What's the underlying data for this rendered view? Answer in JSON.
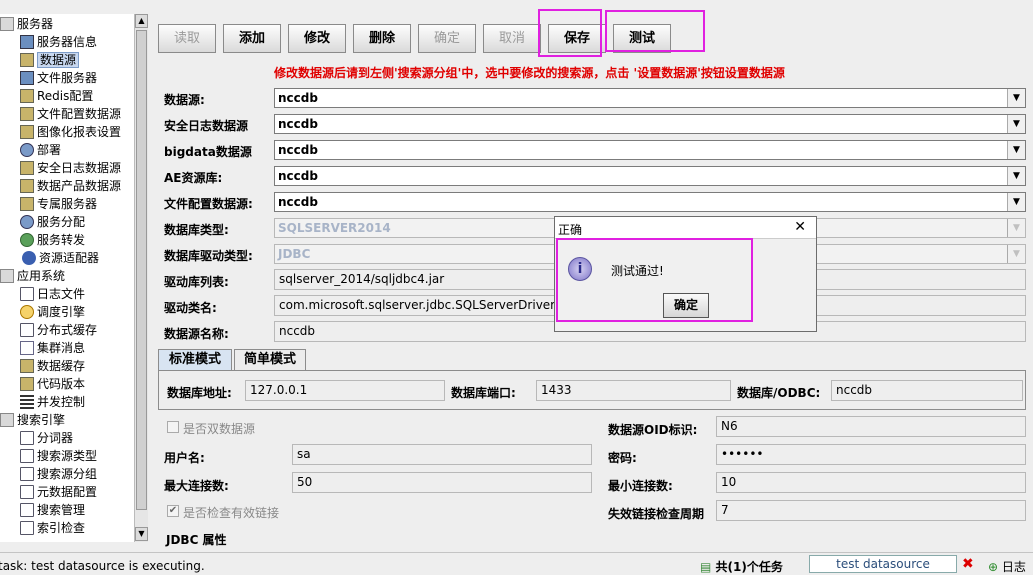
{
  "tree": {
    "items": [
      {
        "label": "服务器",
        "icon": "folder-icon",
        "level": 0
      },
      {
        "label": "服务器信息",
        "icon": "monitor-icon",
        "level": 1
      },
      {
        "label": "数据源",
        "icon": "database-icon",
        "level": 1,
        "selected": true
      },
      {
        "label": "文件服务器",
        "icon": "monitor-icon",
        "level": 1
      },
      {
        "label": "Redis配置",
        "icon": "database-icon",
        "level": 1
      },
      {
        "label": "文件配置数据源",
        "icon": "database-icon",
        "level": 1
      },
      {
        "label": "图像化报表设置",
        "icon": "database-icon",
        "level": 1
      },
      {
        "label": "部署",
        "icon": "deploy-icon",
        "level": 1
      },
      {
        "label": "安全日志数据源",
        "icon": "database-icon",
        "level": 1
      },
      {
        "label": "数据产品数据源",
        "icon": "database-icon",
        "level": 1
      },
      {
        "label": "专属服务器",
        "icon": "database-icon",
        "level": 1
      },
      {
        "label": "服务分配",
        "icon": "gear-icon",
        "level": 1
      },
      {
        "label": "服务转发",
        "icon": "share-icon",
        "level": 1
      },
      {
        "label": "资源适配器",
        "icon": "dot-icon",
        "level": 1
      },
      {
        "label": "应用系统",
        "icon": "folder-icon",
        "level": 0
      },
      {
        "label": "日志文件",
        "icon": "document-icon",
        "level": 1
      },
      {
        "label": "调度引擎",
        "icon": "clock-icon",
        "level": 1
      },
      {
        "label": "分布式缓存",
        "icon": "document-icon",
        "level": 1
      },
      {
        "label": "集群消息",
        "icon": "mail-icon",
        "level": 1
      },
      {
        "label": "数据缓存",
        "icon": "database-icon",
        "level": 1
      },
      {
        "label": "代码版本",
        "icon": "database-icon",
        "level": 1
      },
      {
        "label": "并发控制",
        "icon": "bars-icon",
        "level": 1
      },
      {
        "label": "搜索引擎",
        "icon": "folder-icon",
        "level": 0
      },
      {
        "label": "分词器",
        "icon": "document-icon",
        "level": 1
      },
      {
        "label": "搜索源类型",
        "icon": "document-icon",
        "level": 1
      },
      {
        "label": "搜索源分组",
        "icon": "document-icon",
        "level": 1
      },
      {
        "label": "元数据配置",
        "icon": "document-icon",
        "level": 1
      },
      {
        "label": "搜索管理",
        "icon": "document-icon",
        "level": 1
      },
      {
        "label": "索引检查",
        "icon": "document-icon",
        "level": 1
      }
    ]
  },
  "toolbar": {
    "read": "读取",
    "add": "添加",
    "modify": "修改",
    "delete": "删除",
    "confirm": "确定",
    "cancel": "取消",
    "save": "保存",
    "test": "测试"
  },
  "warning": "修改数据源后请到左侧'搜索源分组'中，选中要修改的搜索源，点击 '设置数据源'按钮设置数据源",
  "form": {
    "datasource_label": "数据源:",
    "datasource_value": "nccdb",
    "security_log_label": "安全日志数据源",
    "security_log_value": "nccdb",
    "bigdata_label": "bigdata数据源",
    "bigdata_value": "nccdb",
    "ae_label": "AE资源库:",
    "ae_value": "nccdb",
    "fileconf_label": "文件配置数据源:",
    "fileconf_value": "nccdb",
    "dbtype_label": "数据库类型:",
    "dbtype_value": "SQLSERVER2014",
    "driver_type_label": "数据库驱动类型:",
    "driver_type_value": "JDBC",
    "driver_lib_label": "驱动库列表:",
    "driver_lib_value": "sqlserver_2014/sqljdbc4.jar",
    "driver_class_label": "驱动类名:",
    "driver_class_value": "com.microsoft.sqlserver.jdbc.SQLServerDriver",
    "ds_name_label": "数据源名称:",
    "ds_name_value": "nccdb"
  },
  "tabs": {
    "standard": "标准模式",
    "simple": "简单模式"
  },
  "conn": {
    "host_label": "数据库地址:",
    "host_value": "127.0.0.1",
    "port_label": "数据库端口:",
    "port_value": "1433",
    "odbc_label": "数据库/ODBC:",
    "odbc_value": "nccdb"
  },
  "more": {
    "dual_label": "是否双数据源",
    "oid_label": "数据源OID标识:",
    "oid_value": "N6",
    "user_label": "用户名:",
    "user_value": "sa",
    "pwd_label": "密码:",
    "pwd_value": "••••••",
    "maxconn_label": "最大连接数:",
    "maxconn_value": "50",
    "minconn_label": "最小连接数:",
    "minconn_value": "10",
    "check_label": "是否检查有效链接",
    "period_label": "失效链接检查周期",
    "period_value": "7",
    "jdbc_label": "JDBC 属性"
  },
  "dialog": {
    "title": "正确",
    "message": "测试通过!",
    "ok": "确定"
  },
  "status": {
    "task": "task: test datasource is executing.",
    "jobs": "共(1)个任务",
    "progress": "test datasource",
    "log": "日志"
  }
}
